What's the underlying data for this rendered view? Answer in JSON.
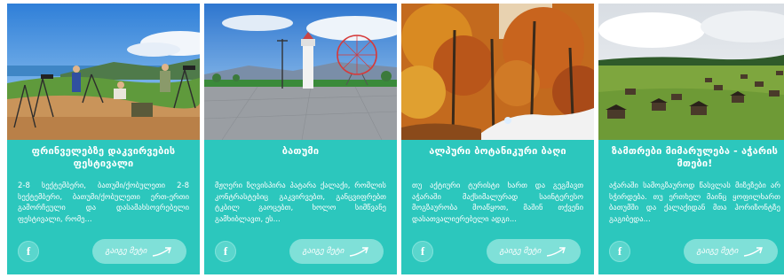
{
  "colors": {
    "card_bg": "#2cc7bd",
    "button_bg": "#7fe0d8",
    "text": "#ffffff"
  },
  "cards": [
    {
      "title": "ფრინველებზე დაკვირვების ფესტივალი",
      "description": "2-8 სექტემბერი, ბათუმი/ქობულეთი 2-8 სექტემბერი, ბათუმი/ქობულეთი ერთ-ერთი გამორჩეული და დასამახსოვრებელი ფესტივალი, რომე...",
      "button": "გაიგე მეტი",
      "icon": "facebook-icon"
    },
    {
      "title": "ბათუმი",
      "description": "მჟღერი ზღვისპირა პატარა ქალაქი, რომლის კონტრასტებიც გაკვირვებთ, განცვიფრებთ ტკბილ გაოცებთ, ხოლო სიმწვანე გამხიბლავთ, ეს...",
      "button": "გაიგე მეტი",
      "icon": "facebook-icon"
    },
    {
      "title": "ალპური ბოტანიკური ბაღი",
      "description": "თუ აქტიური ტურისტი ხართ და გეგმავთ აჭარაში მაქსიმალურად საინტერესო მოგზაურობა მოაწყოთ, მაშინ თქვენი დასათვალიერებელი ადგი...",
      "button": "გაიგე მეტი",
      "icon": "facebook-icon"
    },
    {
      "title": "ზამთრები მიმარულება - აჭარის მთები!",
      "description": "აჭარაში სამოგზაუროდ წასვლას მიზეზები არ სჭირდება. თუ ერთხელ მაინც ყოფილხართ ბათუმში და ქალაქიდან მთა ჰორიზონტზე გაგიბედა...",
      "button": "გაიგე მეტი",
      "icon": "facebook-icon"
    }
  ]
}
